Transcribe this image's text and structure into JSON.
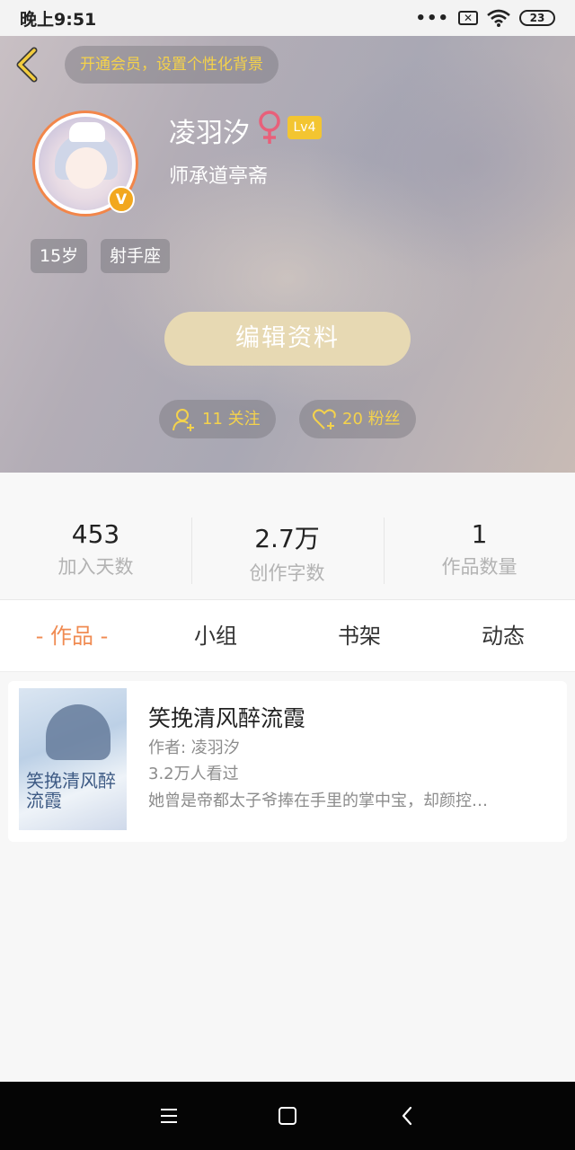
{
  "status_bar": {
    "time": "晚上9:51",
    "dots": "•••",
    "battery": "23"
  },
  "header": {
    "vip_prompt": "开通会员，设置个性化背景",
    "username": "凌羽汐",
    "level": "Lv4",
    "mentor": "师承道亭斋",
    "vip_badge": "V",
    "tags": {
      "age": "15岁",
      "zodiac": "射手座"
    },
    "edit_button": "编辑资料",
    "follow_label": "11 关注",
    "fans_label": "20 粉丝"
  },
  "stats": [
    {
      "value": "453",
      "label": "加入天数"
    },
    {
      "value": "2.7万",
      "label": "创作字数"
    },
    {
      "value": "1",
      "label": "作品数量"
    }
  ],
  "tabs": [
    {
      "label": "- 作品 -"
    },
    {
      "label": "小组"
    },
    {
      "label": "书架"
    },
    {
      "label": "动态"
    }
  ],
  "book": {
    "title": "笑挽清风醉流霞",
    "author": "作者: 凌羽汐",
    "views": "3.2万人看过",
    "description": "她曾是帝都太子爷捧在手里的掌中宝，却颜控…",
    "cover_title": "笑挽清风醉流霞"
  },
  "colors": {
    "accent": "#f08b52",
    "gold": "#f4d24c",
    "edit_button_bg": "#e7d9b3",
    "level_badge": "#f3c531"
  }
}
